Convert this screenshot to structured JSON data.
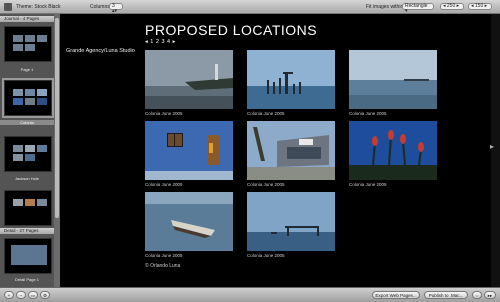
{
  "toolbar": {
    "theme_label": "Theme: Stock Black",
    "columns_label": "Columns:",
    "columns_value": "3",
    "fit_label": "Fit images within:",
    "fit_value": "Rectangle",
    "width_value": "250",
    "height_value": "150"
  },
  "sidebar": {
    "journal_header": "Journal - 4 Pages",
    "detail_header": "Detail - 27 Pages",
    "pages": [
      "Page 1",
      "Colonia",
      "Jackson Hole",
      "Detail Page 1"
    ]
  },
  "main": {
    "title": "PROPOSED LOCATIONS",
    "pager": "◂ 1 2 3 4 ▸",
    "agency": "Grande Agency/Luna Studio",
    "copyright": "© Orlando Luna",
    "photos": [
      {
        "caption": "Colonia June 2005",
        "icon": "lighthouse-shore-photo"
      },
      {
        "caption": "Colonia June 2005",
        "icon": "pier-posts-photo"
      },
      {
        "caption": "Colonia June 2005",
        "icon": "horizon-sea-photo"
      },
      {
        "caption": "Colonia June 2005",
        "icon": "blue-wall-window-photo"
      },
      {
        "caption": "Colonia June 2005",
        "icon": "pool-building-photo"
      },
      {
        "caption": "Colonia June 2005",
        "icon": "aloe-plants-photo"
      },
      {
        "caption": "Colonia June 2005",
        "icon": "rowboat-photo"
      },
      {
        "caption": "Colonia June 2005",
        "icon": "jetty-photo"
      }
    ]
  },
  "bottombar": {
    "export_label": "Export Web Pages...",
    "publish_label": "Publish to .Mac..."
  },
  "colors": {
    "background": "#000000",
    "sidebar": "#545454",
    "toolbar": "#bdbdbd"
  }
}
